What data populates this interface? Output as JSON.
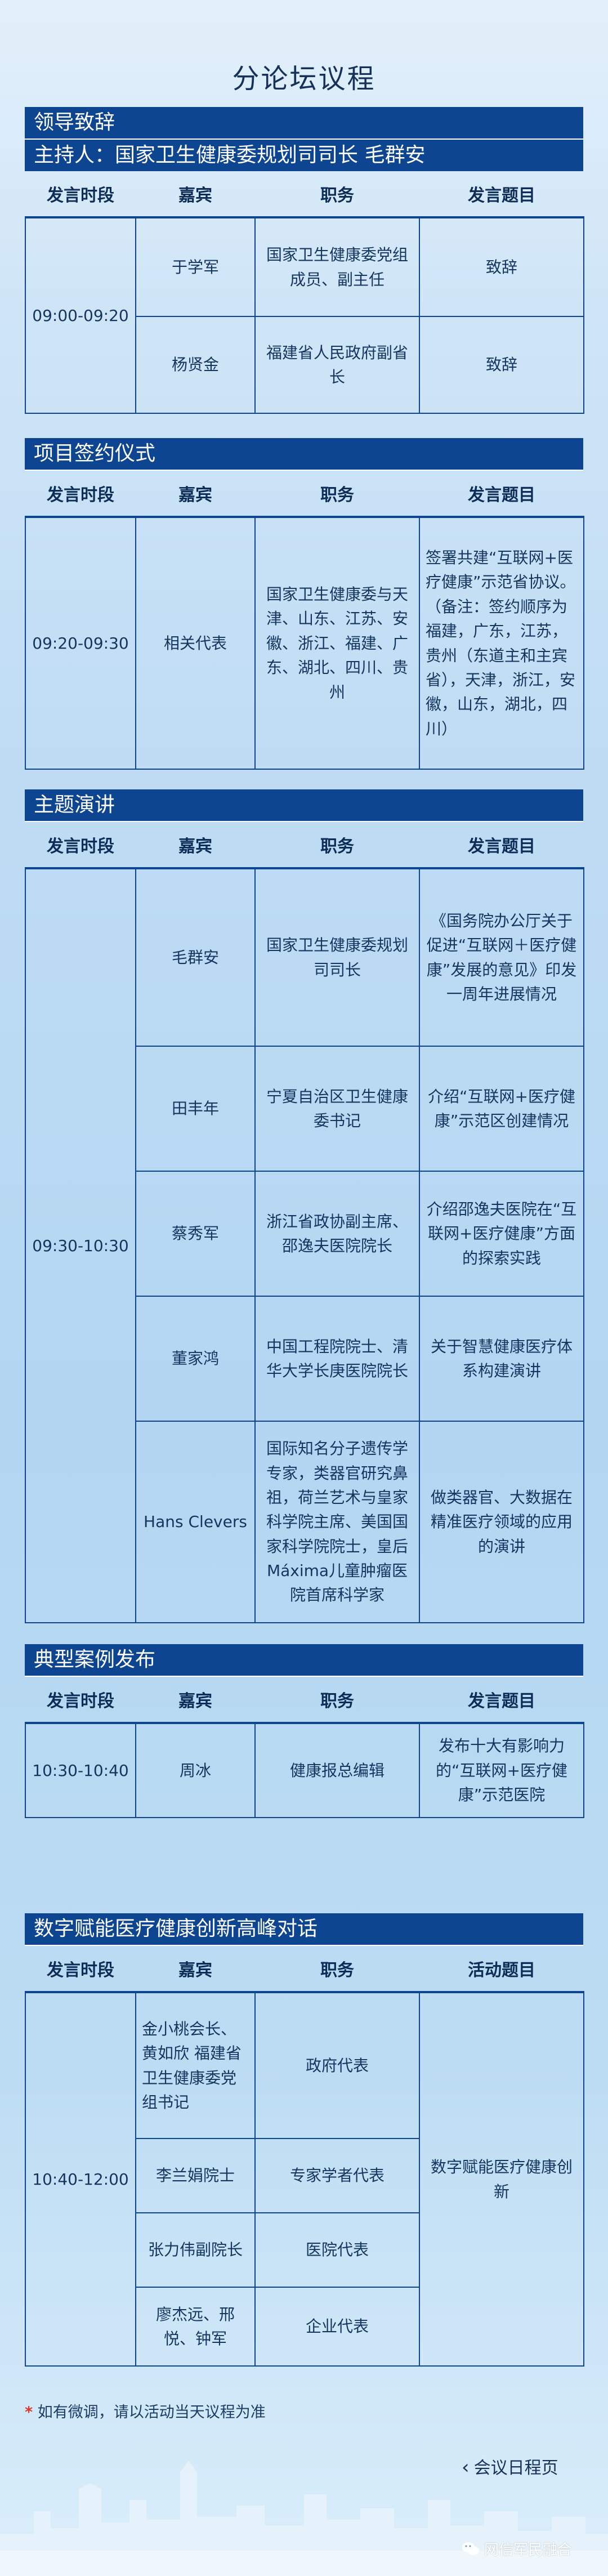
{
  "page": {
    "title": "分论坛议程"
  },
  "columns_default": [
    "发言时段",
    "嘉宾",
    "职务",
    "发言题目"
  ],
  "sections": [
    {
      "title": "领导致辞",
      "host": "主持人：国家卫生健康委规划司司长 毛群安",
      "header": [
        "发言时段",
        "嘉宾",
        "职务",
        "发言题目"
      ],
      "time": "09:00-09:20",
      "rows": [
        {
          "guest": "于学军",
          "title": "国家卫生健康委党组成员、副主任",
          "topic": "致辞"
        },
        {
          "guest": "杨贤金",
          "title": "福建省人民政府副省长",
          "topic": "致辞"
        }
      ]
    },
    {
      "title": "项目签约仪式",
      "header": [
        "发言时段",
        "嘉宾",
        "职务",
        "发言题目"
      ],
      "time": "09:20-09:30",
      "rows": [
        {
          "guest": "相关代表",
          "title": "国家卫生健康委与天津、山东、江苏、安徽、浙江、福建、广东、湖北、四川、贵州",
          "topic": "签署共建“互联网+医疗健康”示范省协议。（备注：签约顺序为福建，广东，江苏，贵州（东道主和主宾省），天津，浙江，安徽，山东，湖北，四川）"
        }
      ]
    },
    {
      "title": "主题演讲",
      "header": [
        "发言时段",
        "嘉宾",
        "职务",
        "发言题目"
      ],
      "time": "09:30-10:30",
      "rows": [
        {
          "guest": "毛群安",
          "title": "国家卫生健康委规划司司长",
          "topic": "《国务院办公厅关于促进“互联网＋医疗健康”发展的意见》印发一周年进展情况"
        },
        {
          "guest": "田丰年",
          "title": "宁夏自治区卫生健康委书记",
          "topic": "介绍“互联网+医疗健康”示范区创建情况"
        },
        {
          "guest": "蔡秀军",
          "title": "浙江省政协副主席、邵逸夫医院院长",
          "topic": "介绍邵逸夫医院在“互联网+医疗健康”方面的探索实践"
        },
        {
          "guest": "董家鸿",
          "title": "中国工程院院士、清华大学长庚医院院长",
          "topic": "关于智慧健康医疗体系构建演讲"
        },
        {
          "guest": "Hans Clevers",
          "title": "国际知名分子遗传学专家，类器官研究鼻祖，荷兰艺术与皇家科学院主席、美国国家科学院院士，皇后Máxima儿童肿瘤医院首席科学家",
          "topic": "做类器官、大数据在精准医疗领域的应用的演讲"
        }
      ]
    },
    {
      "title": "典型案例发布",
      "header": [
        "发言时段",
        "嘉宾",
        "职务",
        "发言题目"
      ],
      "time": "10:30-10:40",
      "rows": [
        {
          "guest": "周冰",
          "title": "健康报总编辑",
          "topic": "发布十大有影响力的“互联网+医疗健康”示范医院"
        }
      ]
    },
    {
      "title": "数字赋能医疗健康创新高峰对话",
      "header": [
        "发言时段",
        "嘉宾",
        "职务",
        "活动题目"
      ],
      "time": "10:40-12:00",
      "topic": "数字赋能医疗健康创新",
      "rows": [
        {
          "guest": "金小桃会长、黄如欣 福建省卫生健康委党组书记",
          "title": "政府代表"
        },
        {
          "guest": "李兰娟院士",
          "title": "专家学者代表"
        },
        {
          "guest": "张力伟副院长",
          "title": "医院代表"
        },
        {
          "guest": "廖杰远、邢悦、钟军",
          "title": "企业代表"
        }
      ]
    }
  ],
  "footnote": {
    "star": "*",
    "text": "如有微调，请以活动当天议程为准"
  },
  "nav": {
    "back_label": "会议日程页"
  },
  "watermark": {
    "text": "网信军民融合"
  },
  "colors": {
    "accent": "#0d4590",
    "background": "#c3dff5"
  }
}
